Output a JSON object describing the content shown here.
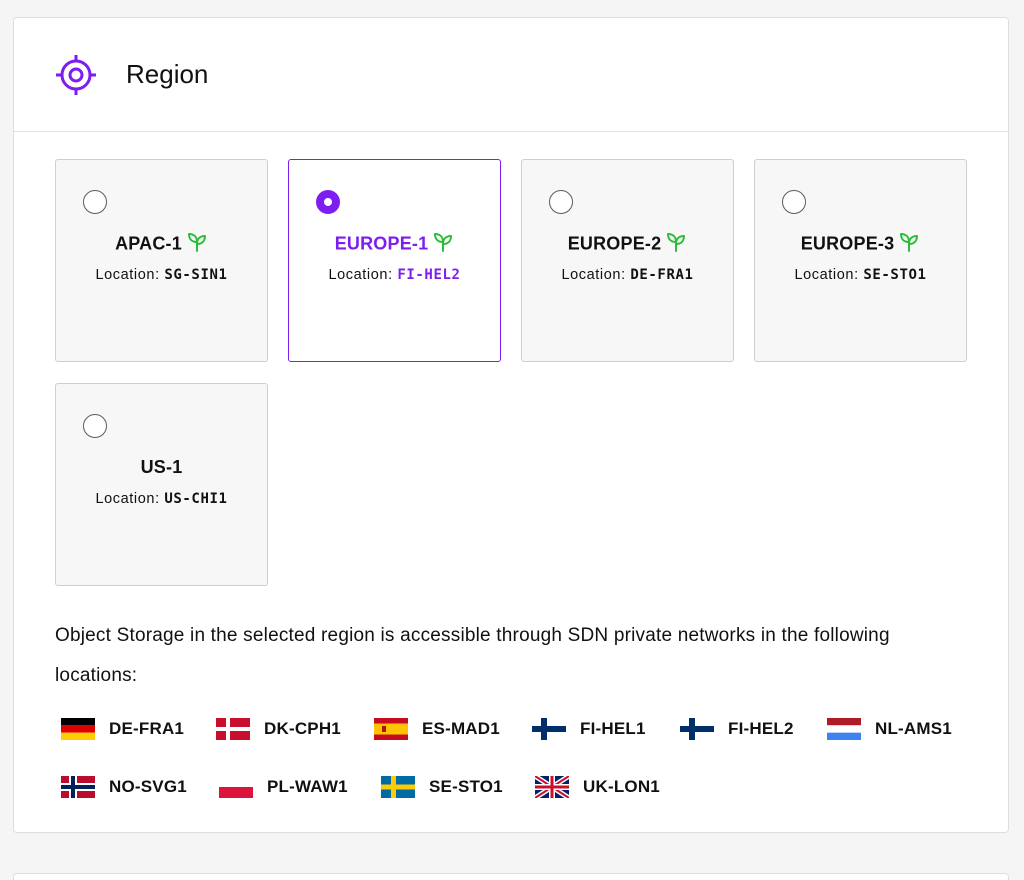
{
  "panel": {
    "title": "Region",
    "icon": "target-icon",
    "accent_color": "#7d1df0",
    "leaf_color": "#2bbd3a"
  },
  "regions": [
    {
      "name": "APAC-1",
      "location_label": "Location:",
      "location_code": "SG-SIN1",
      "selected": false,
      "green": true
    },
    {
      "name": "EUROPE-1",
      "location_label": "Location:",
      "location_code": "FI-HEL2",
      "selected": true,
      "green": true
    },
    {
      "name": "EUROPE-2",
      "location_label": "Location:",
      "location_code": "DE-FRA1",
      "selected": false,
      "green": true
    },
    {
      "name": "EUROPE-3",
      "location_label": "Location:",
      "location_code": "SE-STO1",
      "selected": false,
      "green": true
    },
    {
      "name": "US-1",
      "location_label": "Location:",
      "location_code": "US-CHI1",
      "selected": false,
      "green": false
    }
  ],
  "description": "Object Storage in the selected region is accessible through SDN private networks in the following locations:",
  "locations": [
    {
      "code": "DE-FRA1",
      "flag": "germany-flag-icon"
    },
    {
      "code": "DK-CPH1",
      "flag": "denmark-flag-icon"
    },
    {
      "code": "ES-MAD1",
      "flag": "spain-flag-icon"
    },
    {
      "code": "FI-HEL1",
      "flag": "finland-flag-icon"
    },
    {
      "code": "FI-HEL2",
      "flag": "finland-flag-icon"
    },
    {
      "code": "NL-AMS1",
      "flag": "netherlands-flag-icon"
    },
    {
      "code": "NO-SVG1",
      "flag": "norway-flag-icon"
    },
    {
      "code": "PL-WAW1",
      "flag": "poland-flag-icon"
    },
    {
      "code": "SE-STO1",
      "flag": "sweden-flag-icon"
    },
    {
      "code": "UK-LON1",
      "flag": "uk-flag-icon"
    }
  ]
}
